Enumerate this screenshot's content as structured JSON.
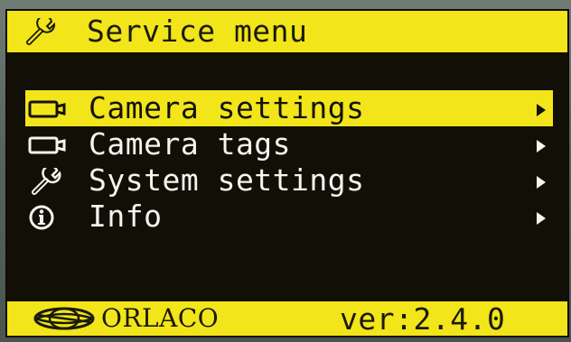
{
  "header": {
    "title": "Service menu",
    "icon": "wrench-icon"
  },
  "menu": {
    "items": [
      {
        "label": "Camera settings",
        "icon": "camera-icon",
        "selected": true,
        "has_submenu": true
      },
      {
        "label": "Camera tags",
        "icon": "camera-icon",
        "selected": false,
        "has_submenu": true
      },
      {
        "label": "System settings",
        "icon": "wrench-icon",
        "selected": false,
        "has_submenu": true
      },
      {
        "label": "Info",
        "icon": "info-icon",
        "selected": false,
        "has_submenu": true
      }
    ]
  },
  "footer": {
    "brand": "ORLACO",
    "version": "ver:2.4.0"
  },
  "colors": {
    "accent": "#f2e51a",
    "background": "#121006",
    "text": "#f4f4f0"
  }
}
